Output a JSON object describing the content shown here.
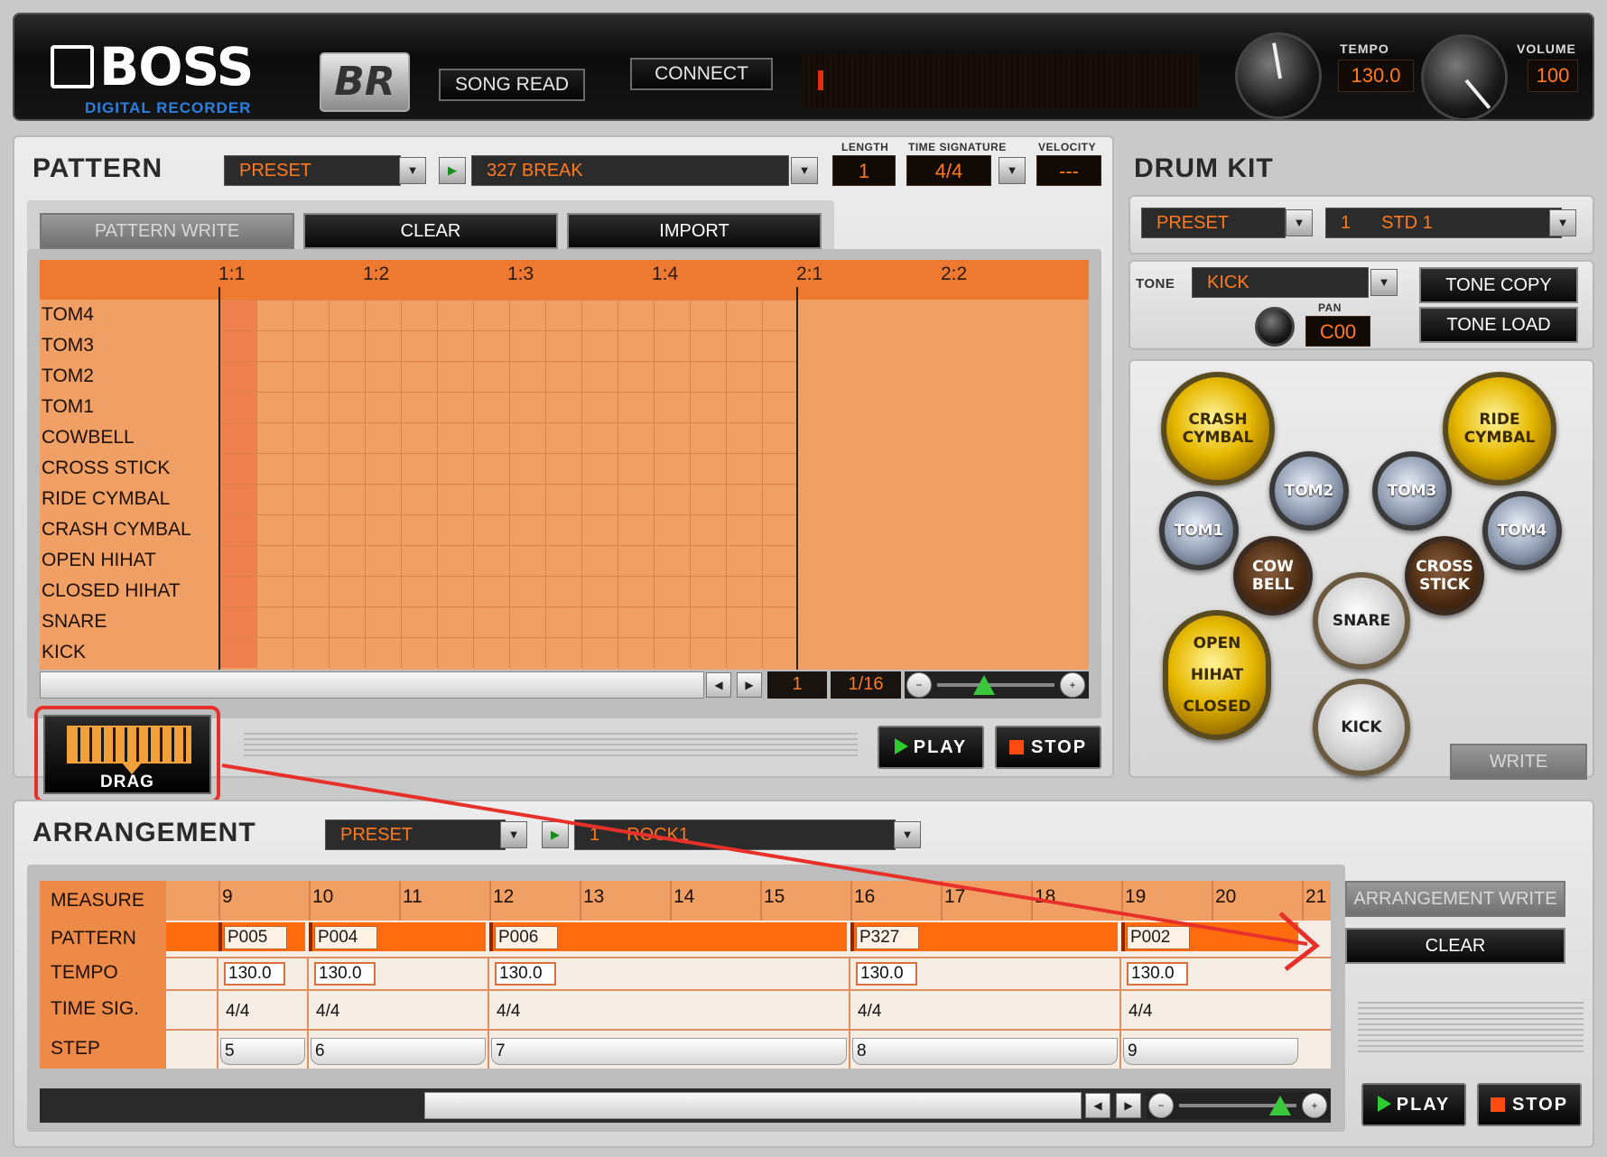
{
  "header": {
    "brand": "BOSS",
    "brand_sub": "DIGITAL RECORDER",
    "br_logo": "BR",
    "song_read_label": "SONG READ",
    "connect_label": "CONNECT",
    "tempo_label": "TEMPO",
    "tempo_value": "130.0",
    "volume_label": "VOLUME",
    "volume_value": "100"
  },
  "pattern": {
    "title": "PATTERN",
    "bank": "PRESET",
    "name": "327  BREAK",
    "length_label": "LENGTH",
    "length_value": "1",
    "timesig_label": "TIME SIGNATURE",
    "timesig_value": "4/4",
    "velocity_label": "VELOCITY",
    "velocity_value": "---",
    "write_label": "PATTERN WRITE",
    "clear_label": "CLEAR",
    "import_label": "IMPORT",
    "ruler": [
      "1:1",
      "1:2",
      "1:3",
      "1:4",
      "2:1",
      "2:2"
    ],
    "rows": [
      "TOM4",
      "TOM3",
      "TOM2",
      "TOM1",
      "COWBELL",
      "CROSS STICK",
      "RIDE CYMBAL",
      "CRASH CYMBAL",
      "OPEN HIHAT",
      "CLOSED HIHAT",
      "SNARE",
      "KICK"
    ],
    "position": "1",
    "resolution": "1/16",
    "drag_label": "DRAG",
    "play_label": "PLAY",
    "stop_label": "STOP"
  },
  "drumkit": {
    "title": "DRUM KIT",
    "bank": "PRESET",
    "kit_number": "1",
    "kit_name": "STD 1",
    "tone_label": "TONE",
    "tone_value": "KICK",
    "pan_label": "PAN",
    "pan_value": "C00",
    "tone_copy_label": "TONE COPY",
    "tone_load_label": "TONE LOAD",
    "write_label": "WRITE",
    "pads": {
      "crash": "CRASH CYMBAL",
      "ride": "RIDE CYMBAL",
      "tom1": "TOM1",
      "tom2": "TOM2",
      "tom3": "TOM3",
      "tom4": "TOM4",
      "cowbell": "COW BELL",
      "cross_stick": "CROSS STICK",
      "snare": "SNARE",
      "hihat_open": "OPEN",
      "hihat_mid": "HIHAT",
      "hihat_closed": "CLOSED",
      "kick": "KICK"
    }
  },
  "arrangement": {
    "title": "ARRANGEMENT",
    "bank": "PRESET",
    "number": "1",
    "name": "ROCK1",
    "write_label": "ARRANGEMENT WRITE",
    "clear_label": "CLEAR",
    "row_labels": [
      "MEASURE",
      "PATTERN",
      "TEMPO",
      "TIME SIG.",
      "STEP"
    ],
    "measures": [
      "9",
      "10",
      "11",
      "12",
      "13",
      "14",
      "15",
      "16",
      "17",
      "18",
      "19",
      "20",
      "21"
    ],
    "segments": [
      {
        "pattern": "P005",
        "tempo": "130.0",
        "timesig": "4/4",
        "step": "5"
      },
      {
        "pattern": "P004",
        "tempo": "130.0",
        "timesig": "4/4",
        "step": "6"
      },
      {
        "pattern": "P006",
        "tempo": "130.0",
        "timesig": "4/4",
        "step": "7"
      },
      {
        "pattern": "P327",
        "tempo": "130.0",
        "timesig": "4/4",
        "step": "8"
      },
      {
        "pattern": "P002",
        "tempo": "130.0",
        "timesig": "4/4",
        "step": "9"
      }
    ],
    "play_label": "PLAY",
    "stop_label": "STOP"
  },
  "icons": {
    "dropdown": "chevron-down-icon",
    "play_small": "play-icon",
    "arrow_left": "arrow-left-icon",
    "arrow_right": "arrow-right-icon",
    "zoom_out": "zoom-out-icon",
    "zoom_in": "zoom-in-icon"
  },
  "colors": {
    "accent": "#ff7a1e",
    "grid_bg": "#f0a064",
    "highlight": "#e8302a"
  }
}
